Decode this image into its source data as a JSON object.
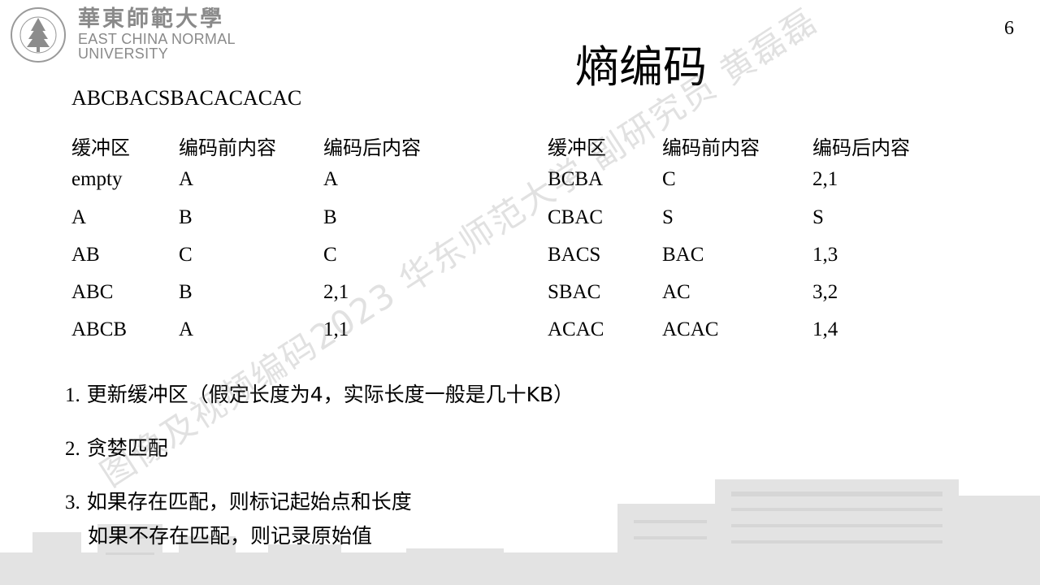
{
  "header": {
    "university_cn": "華東師範大學",
    "university_en_line1": "EAST CHINA NORMAL",
    "university_en_line2": "UNIVERSITY",
    "page_number": "6"
  },
  "title": "熵编码",
  "sequence": "ABCBACSBACACACAC",
  "tables": [
    {
      "headers": [
        "缓冲区",
        "编码前内容",
        "编码后内容"
      ],
      "rows": [
        [
          "empty",
          "A",
          "A"
        ],
        [
          "A",
          "B",
          "B"
        ],
        [
          "AB",
          "C",
          "C"
        ],
        [
          "ABC",
          "B",
          "2,1"
        ],
        [
          "ABCB",
          "A",
          "1,1"
        ]
      ]
    },
    {
      "headers": [
        "缓冲区",
        "编码前内容",
        "编码后内容"
      ],
      "rows": [
        [
          "BCBA",
          "C",
          "2,1"
        ],
        [
          "CBAC",
          "S",
          "S"
        ],
        [
          "BACS",
          "BAC",
          "1,3"
        ],
        [
          "SBAC",
          "AC",
          "3,2"
        ],
        [
          "ACAC",
          "ACAC",
          "1,4"
        ]
      ]
    }
  ],
  "notes": [
    {
      "num": "1.",
      "text": "更新缓冲区（假定长度为4，实际长度一般是几十KB）"
    },
    {
      "num": "2.",
      "text": "贪婪匹配"
    },
    {
      "num": "3.",
      "text": "如果存在匹配，则标记起始点和长度"
    },
    {
      "num": "",
      "text": "如果不存在匹配，则记录原始值"
    }
  ],
  "watermark": "图像及视频编码2023 华东师范大学 副研究员 黄磊磊"
}
